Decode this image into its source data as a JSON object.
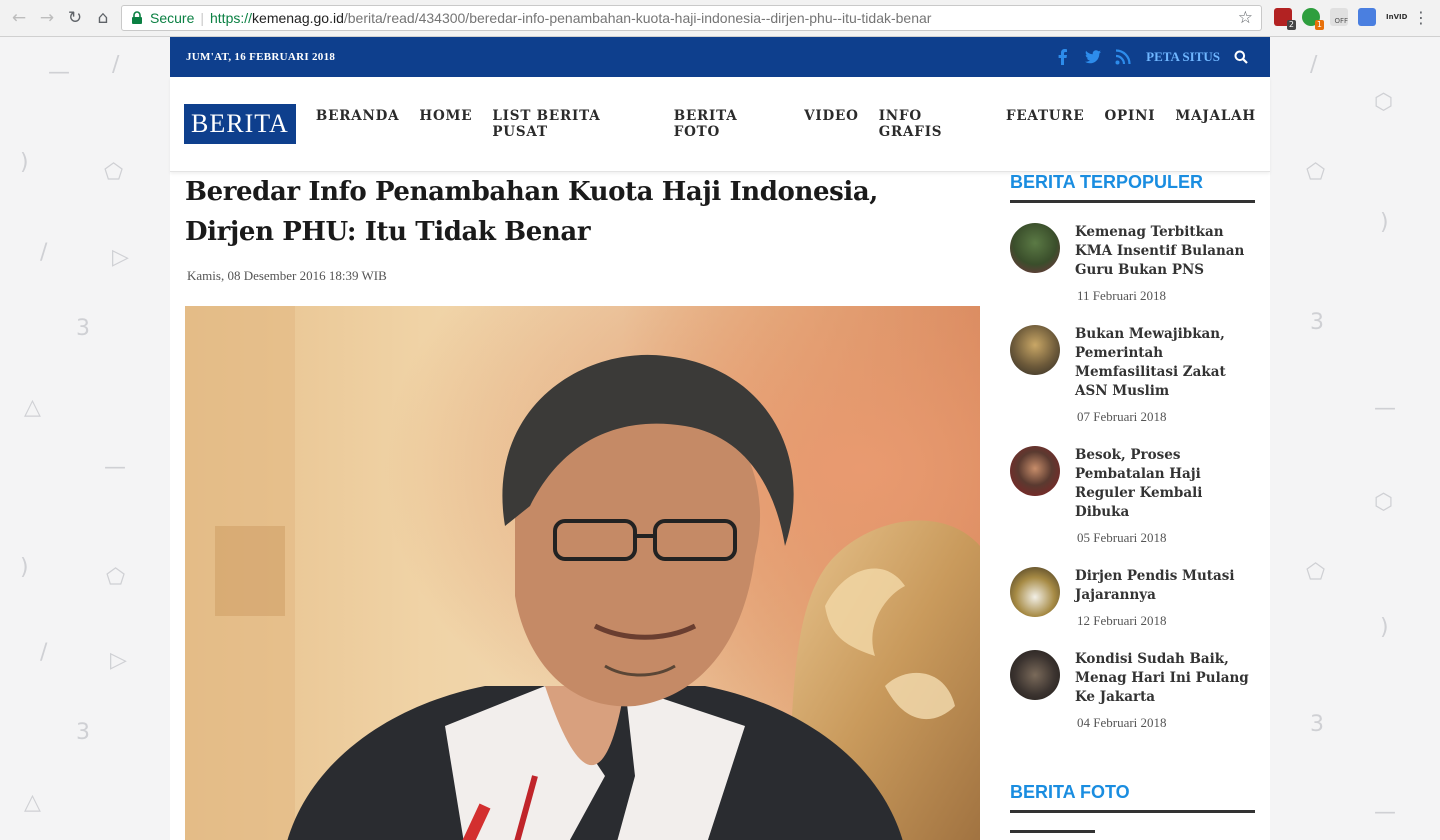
{
  "browser": {
    "secure_label": "Secure",
    "url_scheme": "https://",
    "url_host": "kemenag.go.id",
    "url_path": "/berita/read/434300/beredar-info-penambahan-kuota-haji-indonesia--dirjen-phu--itu-tidak-benar",
    "extensions": [
      {
        "name": "ublock-extension-icon",
        "badge": "2",
        "color": "#b22222"
      },
      {
        "name": "vpn-extension-icon",
        "badge": "1",
        "color": "#2e9e3e"
      },
      {
        "name": "off-extension-icon",
        "badge": "OFF",
        "color": "#9e9e9e"
      },
      {
        "name": "translate-extension-icon",
        "badge": "",
        "color": "#4a7fe0"
      },
      {
        "name": "invid-extension-icon",
        "badge": "InVID",
        "color": "#555555"
      }
    ]
  },
  "topbar": {
    "date": "JUM'AT, 16 FEBRUARI 2018",
    "peta_situs": "PETA SITUS"
  },
  "header": {
    "logo_text": "BERITA",
    "menu": [
      "BERANDA",
      "HOME",
      "LIST BERITA PUSAT",
      "BERITA FOTO",
      "VIDEO",
      "INFO GRAFIS",
      "FEATURE",
      "OPINI",
      "MAJALAH"
    ]
  },
  "article": {
    "title": "Beredar Info Penambahan Kuota Haji Indonesia, Dirjen PHU: Itu Tidak Benar",
    "date": "Kamis, 08 Desember 2016 18:39 WIB"
  },
  "sidebar": {
    "popular_title": "BERITA TERPOPULER",
    "popular": [
      {
        "title": "Kemenag Terbitkan KMA Insentif Bulanan Guru Bukan PNS",
        "date": "11 Februari 2018"
      },
      {
        "title": "Bukan Mewajibkan, Pemerintah Memfasilitasi Zakat ASN Muslim",
        "date": "07 Februari 2018"
      },
      {
        "title": "Besok, Proses Pembatalan Haji Reguler Kembali Dibuka",
        "date": "05 Februari 2018"
      },
      {
        "title": "Dirjen Pendis Mutasi Jajarannya",
        "date": "12 Februari 2018"
      },
      {
        "title": "Kondisi Sudah Baik, Menag Hari Ini Pulang Ke Jakarta",
        "date": "04 Februari 2018"
      }
    ],
    "foto_title": "BERITA FOTO"
  },
  "colors": {
    "brand_blue": "#0e3f8d",
    "accent_blue": "#1a8de0",
    "secure_green": "#0b8043"
  }
}
